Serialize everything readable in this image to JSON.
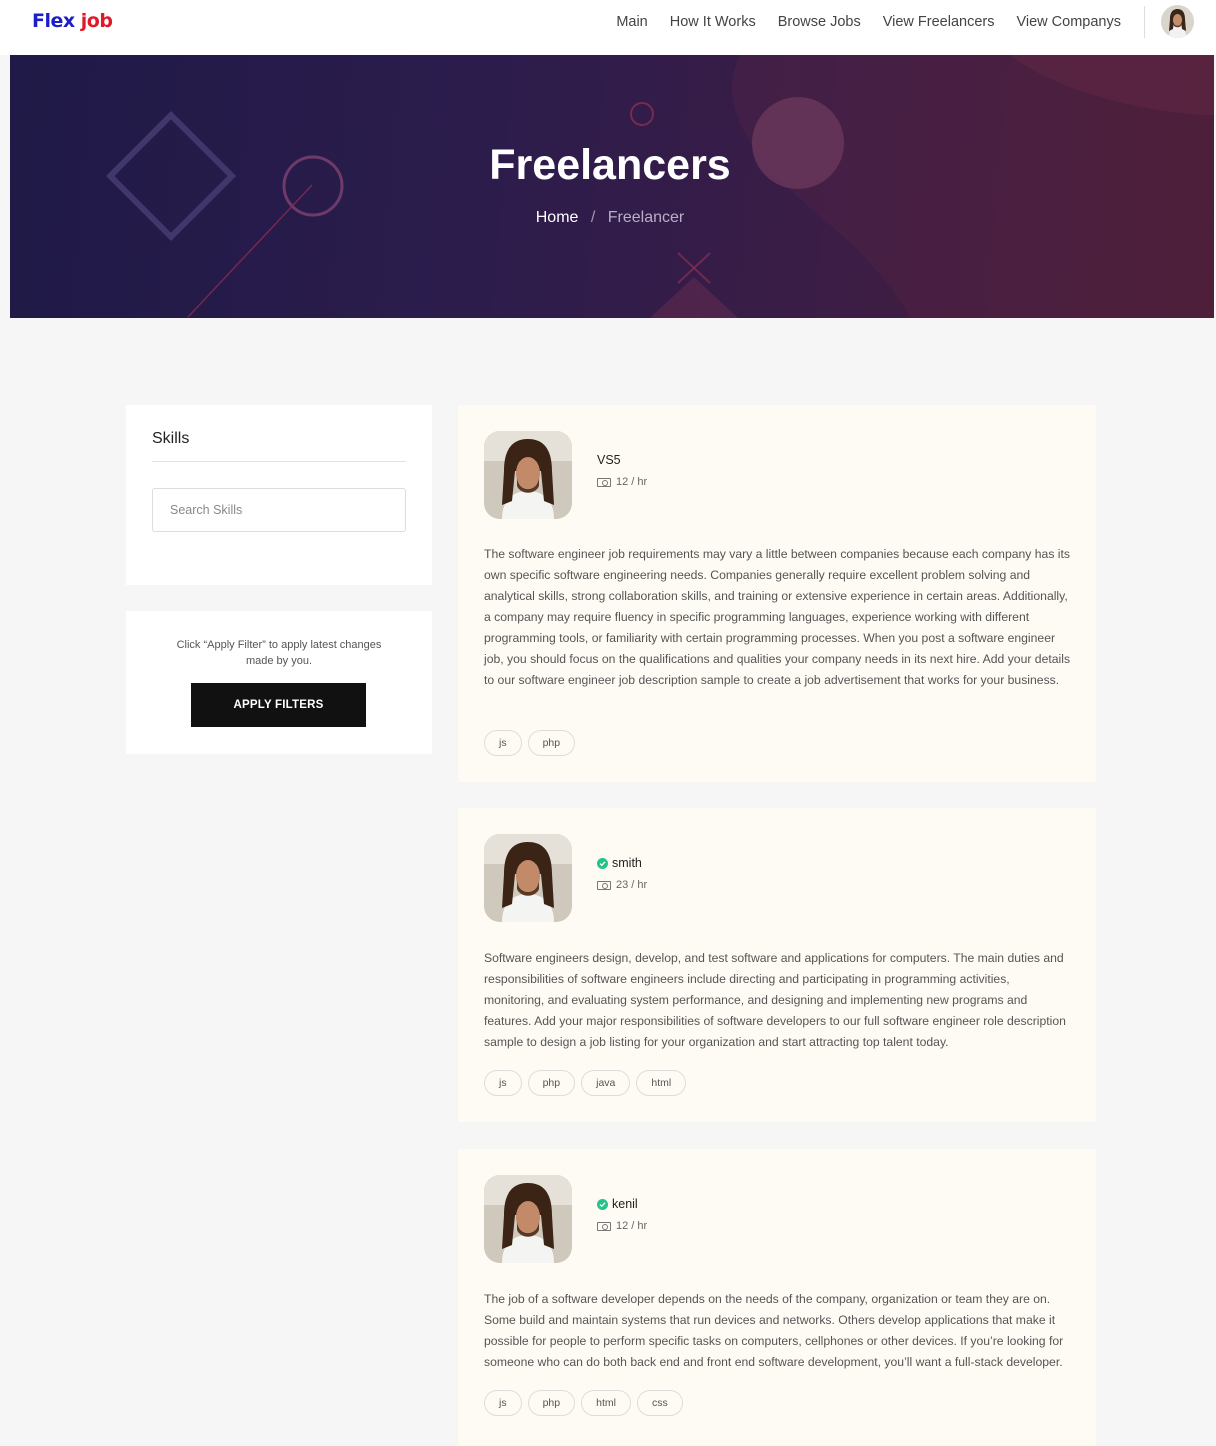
{
  "header": {
    "logo_part1": "Flex",
    "logo_part2": "job",
    "nav": [
      {
        "label": "Main"
      },
      {
        "label": "How It Works"
      },
      {
        "label": "Browse Jobs"
      },
      {
        "label": "View Freelancers"
      },
      {
        "label": "View Companys"
      }
    ],
    "avatar_icon": "user-avatar"
  },
  "hero": {
    "title": "Freelancers",
    "breadcrumb": {
      "home": "Home",
      "separator": "/",
      "current": "Freelancer"
    }
  },
  "sidebar": {
    "skills_title": "Skills",
    "search_placeholder": "Search Skills",
    "filter_note": "Click “Apply Filter” to apply latest changes made by you.",
    "apply_label": "APPLY FILTERS"
  },
  "freelancers": [
    {
      "name": "VS5",
      "verified": false,
      "rate": "12 / hr",
      "description": "The software engineer job requirements may vary a little between companies because each company has its own specific software engineering needs. Companies generally require excellent problem solving and analytical skills, strong collaboration skills, and training or extensive experience in certain areas. Additionally, a company may require fluency in specific programming languages, experience working with different programming tools, or familiarity with certain programming processes. When you post a software engineer job, you should focus on the qualifications and qualities your company needs in its next hire. Add your details to our software engineer job description sample to create a job advertisement that works for your business.",
      "tags": [
        "js",
        "php"
      ]
    },
    {
      "name": "smith",
      "verified": true,
      "rate": "23 / hr",
      "description": "Software engineers design, develop, and test software and applications for computers. The main duties and responsibilities of software engineers include directing and participating in programming activities, monitoring, and evaluating system performance, and designing and implementing new programs and features. Add your major responsibilities of software developers to our full software engineer role description sample to design a job listing for your organization and start attracting top talent today.",
      "tags": [
        "js",
        "php",
        "java",
        "html"
      ]
    },
    {
      "name": "kenil",
      "verified": true,
      "rate": "12 / hr",
      "description": "The job of a software developer depends on the needs of the company, organization or team they are on. Some build and maintain systems that run devices and networks. Others develop applications that make it possible for people to perform specific tasks on computers, cellphones or other devices. If you’re looking for someone who can do both back end and front end software development, you’ll want a full-stack developer.",
      "tags": [
        "js",
        "php",
        "html",
        "css"
      ]
    }
  ],
  "colors": {
    "logo_blue": "#1c1fc6",
    "logo_red": "#e0182a",
    "verified_green": "#23c38a",
    "button_dark": "#111111",
    "card_bg": "#fdfbf3"
  }
}
